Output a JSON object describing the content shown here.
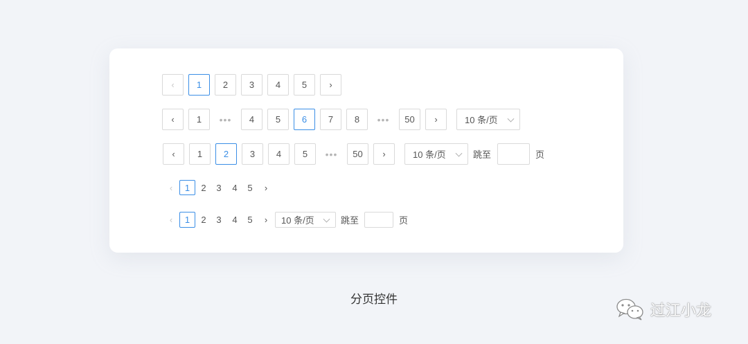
{
  "icons": {
    "prev": "‹",
    "next": "›"
  },
  "row1": {
    "pages": [
      "1",
      "2",
      "3",
      "4",
      "5"
    ]
  },
  "row2": {
    "pages": [
      "1",
      "4",
      "5",
      "6",
      "7",
      "8",
      "50"
    ],
    "ellipsis": "•••",
    "page_size": "10 条/页"
  },
  "row3": {
    "pages": [
      "1",
      "2",
      "3",
      "4",
      "5",
      "50"
    ],
    "ellipsis": "•••",
    "page_size": "10 条/页",
    "jump_label": "跳至",
    "page_unit": "页",
    "jump_value": ""
  },
  "row4": {
    "pages": [
      "1",
      "2",
      "3",
      "4",
      "5"
    ]
  },
  "row5": {
    "pages": [
      "1",
      "2",
      "3",
      "4",
      "5"
    ],
    "page_size": "10 条/页",
    "jump_label": "跳至",
    "page_unit": "页",
    "jump_value": ""
  },
  "caption": "分页控件",
  "watermark": {
    "text": "过江小龙"
  },
  "colors": {
    "active": "#3a8ee6",
    "border": "#d9d9d9",
    "background": "#f2f4f8"
  }
}
